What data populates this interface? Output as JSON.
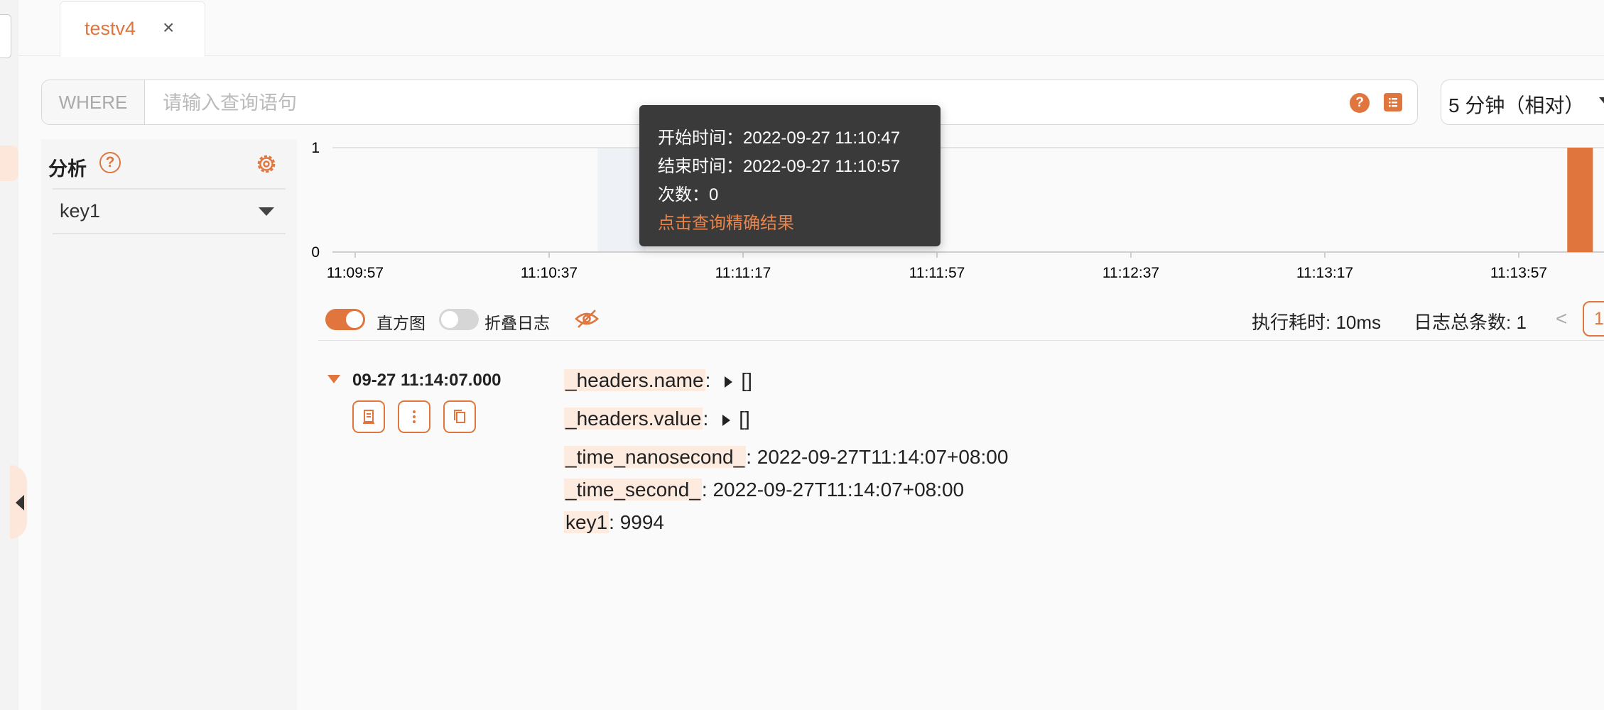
{
  "tab": {
    "title": "testv4",
    "close": "×"
  },
  "query": {
    "where_label": "WHERE",
    "placeholder": "请输入查询语句",
    "help_badge": "?",
    "time_range": "5 分钟（相对）"
  },
  "analysis": {
    "title": "分析",
    "help": "?",
    "field": "key1"
  },
  "chart_data": {
    "type": "bar",
    "y_ticks": [
      "1",
      "0"
    ],
    "ylim": [
      0,
      1
    ],
    "x_ticks": [
      "11:09:57",
      "11:10:37",
      "11:11:17",
      "11:11:57",
      "11:12:37",
      "11:13:17",
      "11:13:57"
    ],
    "bars": [
      {
        "start": "11:10:47",
        "end": "11:10:57",
        "count": 0,
        "hovered": true
      },
      {
        "start": "11:14:07",
        "end": "11:14:12",
        "count": 1,
        "hovered": false
      }
    ],
    "bar_color": "#e0763d",
    "hover_color": "#eef1f6"
  },
  "tooltip": {
    "start": "开始时间：2022-09-27 11:10:47",
    "end": "结束时间：2022-09-27 11:10:57",
    "count": "次数：0",
    "link": "点击查询精确结果"
  },
  "controls": {
    "histogram_label": "直方图",
    "histogram_on": true,
    "fold_label": "折叠日志",
    "fold_on": false,
    "exec_time": "执行耗时: 10ms",
    "total": "日志总条数: 1",
    "pager_prev": "<",
    "page": "1"
  },
  "log": {
    "time": "09-27 11:14:07.000",
    "fields": [
      {
        "key": "_headers.name",
        "value": "[]",
        "expandable": true
      },
      {
        "key": "_headers.value",
        "value": "[]",
        "expandable": true
      },
      {
        "key": "_time_nanosecond_",
        "value": "2022-09-27T11:14:07+08:00",
        "expandable": false
      },
      {
        "key": "_time_second_",
        "value": "2022-09-27T11:14:07+08:00",
        "expandable": false
      },
      {
        "key": "key1",
        "value": "9994",
        "expandable": false
      }
    ]
  },
  "colors": {
    "accent": "#e0763d",
    "tooltip_bg": "#3a3a3a"
  }
}
